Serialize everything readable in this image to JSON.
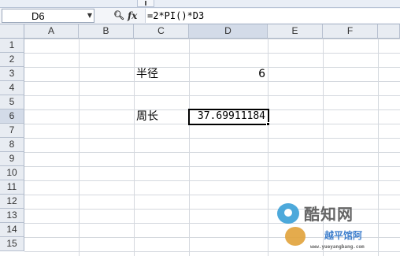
{
  "formula_bar": {
    "name_box": "D6",
    "name_box_dropdown": "▼",
    "zoom_icon": "search-icon",
    "fx_label": "fx",
    "formula": "=2*PI()*D3"
  },
  "sheet": {
    "columns": [
      "A",
      "B",
      "C",
      "D",
      "E",
      "F"
    ],
    "rows": [
      "1",
      "2",
      "3",
      "4",
      "5",
      "6",
      "7",
      "8",
      "9",
      "10",
      "11",
      "12",
      "13",
      "14",
      "15"
    ],
    "active_cell": "D6",
    "cells": {
      "C3": "半径",
      "D3": "6",
      "C6": "周长",
      "D6": "37.69911184"
    }
  },
  "watermark": {
    "title": "酷知网",
    "subtitle": "越平馆阿",
    "url": "www.yueyangbang.com"
  }
}
